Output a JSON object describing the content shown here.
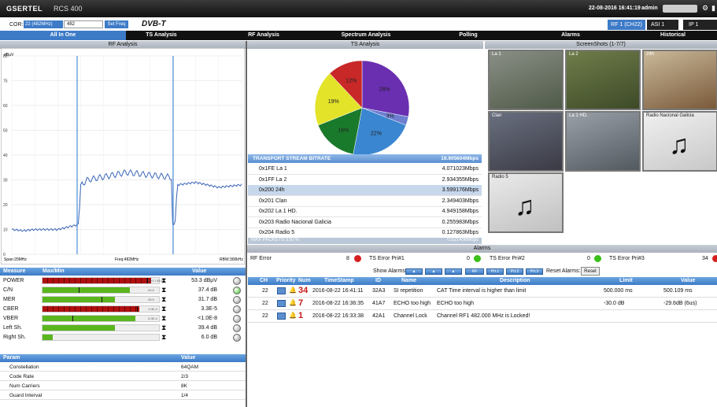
{
  "header": {
    "brand": "GSERTEL",
    "model": "RCS 400",
    "datetime": "22-08-2016 16:41:19",
    "user": "admin"
  },
  "toolbar": {
    "cor_label": "COR:",
    "cor_value": "22 (482MHz)",
    "freq_value": "482",
    "set_freq": "Set Freq",
    "dvb": "DVB-T",
    "rf_tab": "RF 1 (CH22)",
    "asi_tab": "ASI 1",
    "ip_tab": "IP 1"
  },
  "nav": [
    "All In One",
    "TS Analysis",
    "RF Analysis",
    "Spectrum Analysis",
    "Polling",
    "Alarms",
    "Historical"
  ],
  "rf_panel": {
    "title": "RF Analysis",
    "y_unit": "dBµV",
    "y_ticks": [
      "80",
      "75",
      "60",
      "50",
      "40",
      "30",
      "20",
      "10",
      "0"
    ],
    "span": "Span:20MHz",
    "freq": "Freq:482MHz",
    "rbw": "RBW:300kHz"
  },
  "chart_data": {
    "type": "line",
    "title": "RF Analysis",
    "ylabel": "dBµV",
    "ylim": [
      0,
      80
    ],
    "x": [
      "-10",
      "-8",
      "-6",
      "-4",
      "-3.9",
      "-3.8",
      "-2",
      "0",
      "2",
      "3.8",
      "3.9",
      "4",
      "6",
      "8",
      "10"
    ],
    "values": [
      10,
      9.5,
      10,
      10,
      12,
      28,
      30,
      33,
      31,
      30,
      12,
      28,
      29,
      27,
      28
    ]
  },
  "measures": {
    "header_measure": "Measure",
    "header_maxmin": "Max/Min",
    "header_value": "Value",
    "rows": [
      {
        "name": "POWER",
        "value": "53.3 dBµV",
        "tick": "50.0 / 55.0",
        "fill": 0.93,
        "color": "#b01010",
        "mark": 0.9,
        "status": "#999"
      },
      {
        "name": "C/N",
        "value": "37.4 dB",
        "tick": "20.0",
        "fill": 0.75,
        "color": "#5bb51e",
        "mark": 0.31,
        "status": "#3bbf1c"
      },
      {
        "name": "MER",
        "value": "31.7 dB",
        "tick": "25.0",
        "fill": 0.62,
        "color": "#5bb51e",
        "mark": 0.51,
        "status": "#999"
      },
      {
        "name": "CBER",
        "value": "3.3E-5",
        "tick": "1.0E-4",
        "fill": 0.83,
        "color": "#b01010",
        "mark": 0.81,
        "status": "#999"
      },
      {
        "name": "VBER",
        "value": "<1.0E-8",
        "tick": "2.0E-4",
        "fill": 0.8,
        "color": "#5bb51e",
        "mark": 0.26,
        "status": "#999"
      },
      {
        "name": "Left Sh.",
        "value": "39.4 dB",
        "tick": "",
        "fill": 0.62,
        "color": "#5bb51e",
        "mark": -1,
        "status": "#999"
      },
      {
        "name": "Right Sh.",
        "value": "6.0 dB",
        "tick": "",
        "fill": 0.09,
        "color": "#5bb51e",
        "mark": -1,
        "status": "#999"
      }
    ]
  },
  "params": {
    "header_param": "Param",
    "header_value": "Value",
    "rows": [
      {
        "k": "Constellation",
        "v": "64QAM"
      },
      {
        "k": "Code Rate",
        "v": "2/3"
      },
      {
        "k": "Num Carriers",
        "v": "8K"
      },
      {
        "k": "Guard Interval",
        "v": "1/4"
      }
    ]
  },
  "ts_panel": {
    "title": "TS Analysis",
    "pie": [
      {
        "label": "28%",
        "value": 28,
        "color": "#6a2fb0"
      },
      {
        "label": "3%",
        "value": 3,
        "color": "#6e7fd0"
      },
      {
        "label": "22%",
        "value": 22,
        "color": "#3a86d0"
      },
      {
        "label": "16%",
        "value": 16,
        "color": "#1a7a2c"
      },
      {
        "label": "19%",
        "value": 19,
        "color": "#e3e32a"
      },
      {
        "label": "12%",
        "value": 12,
        "color": "#c82828"
      }
    ],
    "bitrate_label": "TRANSPORT STREAM BITRATE",
    "bitrate_value": "19.905604Mbps",
    "rows": [
      {
        "n": "0x1FE La 1",
        "r": "4.071023Mbps"
      },
      {
        "n": "0x1FF La 2",
        "r": "2.934355Mbps"
      },
      {
        "n": "0x200 24h",
        "r": "3.599176Mbps"
      },
      {
        "n": "0x201 Clan",
        "r": "2.349403Mbps"
      },
      {
        "n": "0x202 La 1 HD.",
        "r": "4.949158Mbps"
      },
      {
        "n": "0x203 Radio Nacional Galicia",
        "r": "0.255983Mbps"
      },
      {
        "n": "0x204 Radio 5",
        "r": "0.127863Mbps"
      }
    ],
    "footer_l": "MAX PACKETS 3.87%",
    "footer_r": "0.521406Mbps"
  },
  "screens": {
    "title": "ScreenShots (1-7/7)",
    "items": [
      "La 1",
      "La 2",
      "24h",
      "Clan",
      "La 1 HD.",
      "Radio Nacional Galicia",
      "Radio 5"
    ]
  },
  "alarms": {
    "title": "Alarms",
    "rf_error": "RF Error",
    "rf_error_count": "8",
    "ts1": "TS Error Pri#1",
    "ts1_count": "0",
    "ts2": "TS Error Pri#2",
    "ts2_count": "0",
    "ts3": "TS Error Pri#3",
    "ts3_count": "34",
    "show": "Show Alarms:",
    "btn_rf": "RF",
    "btn_p1": "Pri.1",
    "btn_p2": "Pri.2",
    "btn_p3": "Pri.3",
    "reset_label": "Reset Alarms:",
    "reset": "Reset",
    "cols": [
      "CH",
      "Priority",
      "Num",
      "TimeStamp",
      "ID",
      "Name",
      "Description",
      "Limit",
      "Value"
    ],
    "rows": [
      {
        "ch": "22",
        "num": "34",
        "ts": "2016-08-22 16:41:11",
        "id": "32A3",
        "name": "SI repetition",
        "desc": "CAT Time interval is higher than limit",
        "limit": "500.000 ms",
        "value": "500.109 ms"
      },
      {
        "ch": "22",
        "num": "7",
        "ts": "2016-08-22 16:36:35",
        "id": "41A7",
        "name": "ECHO too high",
        "desc": "ECHO too high",
        "limit": "-30.0 dB",
        "value": "-29.6dB (6us)"
      },
      {
        "ch": "22",
        "num": "1",
        "ts": "2016-08-22 16:33:38",
        "id": "42A1",
        "name": "Channel Lock",
        "desc": "Channel RF1 482.000 MHz is Locked!",
        "limit": "",
        "value": ""
      }
    ]
  }
}
